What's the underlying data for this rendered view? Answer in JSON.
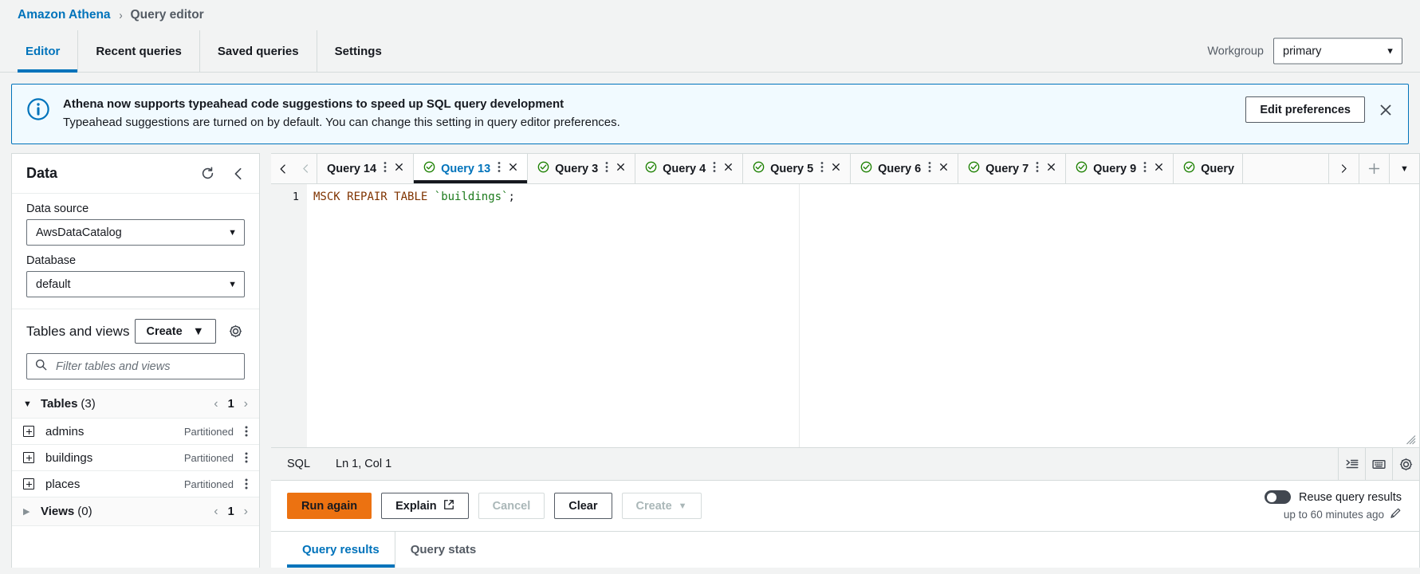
{
  "breadcrumb": {
    "root": "Amazon Athena",
    "separator": "›",
    "current": "Query editor"
  },
  "topnav": {
    "tabs": [
      {
        "label": "Editor",
        "active": true
      },
      {
        "label": "Recent queries",
        "active": false
      },
      {
        "label": "Saved queries",
        "active": false
      },
      {
        "label": "Settings",
        "active": false
      }
    ],
    "workgroup_label": "Workgroup",
    "workgroup_value": "primary"
  },
  "notification": {
    "icon": "info-icon",
    "title": "Athena now supports typeahead code suggestions to speed up SQL query development",
    "text": "Typeahead suggestions are turned on by default. You can change this setting in query editor preferences.",
    "action_label": "Edit preferences",
    "dismiss_icon": "close-icon",
    "accent_color": "#0073bb",
    "background_color": "#f1faff"
  },
  "sidebar": {
    "title": "Data",
    "refresh_icon": "refresh-icon",
    "collapse_icon": "chevron-left-icon",
    "data_source_label": "Data source",
    "data_source_value": "AwsDataCatalog",
    "database_label": "Database",
    "database_value": "default",
    "tables_views_title": "Tables and views",
    "create_label": "Create",
    "settings_icon": "gear-icon",
    "filter_placeholder": "Filter tables and views",
    "filter_value": "",
    "groups": [
      {
        "name": "Tables",
        "count": "(3)",
        "expanded": true,
        "page": "1",
        "items": [
          {
            "name": "admins",
            "badge": "Partitioned"
          },
          {
            "name": "buildings",
            "badge": "Partitioned"
          },
          {
            "name": "places",
            "badge": "Partitioned"
          }
        ]
      },
      {
        "name": "Views",
        "count": "(0)",
        "expanded": false,
        "page": "1",
        "items": []
      }
    ]
  },
  "editor": {
    "tabs": [
      {
        "label": "Query 14",
        "active": false,
        "status": "none"
      },
      {
        "label": "Query 13",
        "active": true,
        "status": "success"
      },
      {
        "label": "Query 3",
        "active": false,
        "status": "success"
      },
      {
        "label": "Query 4",
        "active": false,
        "status": "success"
      },
      {
        "label": "Query 5",
        "active": false,
        "status": "success"
      },
      {
        "label": "Query 6",
        "active": false,
        "status": "success"
      },
      {
        "label": "Query 7",
        "active": false,
        "status": "success"
      },
      {
        "label": "Query 9",
        "active": false,
        "status": "success"
      },
      {
        "label": "Query",
        "active": false,
        "status": "success"
      }
    ],
    "tab_prev_icon": "chevron-left-icon",
    "tab_next_icon": "chevron-right-icon",
    "tab_add_icon": "plus-icon",
    "tab_menu_icon": "chevron-down-icon",
    "line_number": "1",
    "code_tokens": [
      {
        "text": "MSCK",
        "type": "keyword"
      },
      {
        "text": " ",
        "type": "plain"
      },
      {
        "text": "REPAIR",
        "type": "keyword"
      },
      {
        "text": " ",
        "type": "plain"
      },
      {
        "text": "TABLE",
        "type": "keyword"
      },
      {
        "text": " ",
        "type": "plain"
      },
      {
        "text": "`buildings`",
        "type": "identifier"
      },
      {
        "text": ";",
        "type": "punct"
      }
    ],
    "code_text": "MSCK REPAIR TABLE `buildings`;",
    "status_language": "SQL",
    "status_position": "Ln 1, Col 1",
    "status_icons": [
      "format-indent-icon",
      "keyboard-icon",
      "gear-icon"
    ]
  },
  "actions": {
    "run_label": "Run again",
    "explain_label": "Explain",
    "explain_icon": "external-link-icon",
    "cancel_label": "Cancel",
    "cancel_disabled": true,
    "clear_label": "Clear",
    "create_label": "Create",
    "create_disabled": true,
    "primary_color": "#ec7211"
  },
  "reuse": {
    "label": "Reuse query results",
    "enabled": false,
    "sub_label": "up to 60 minutes ago",
    "edit_icon": "pencil-icon"
  },
  "results": {
    "tabs": [
      {
        "label": "Query results",
        "active": true
      },
      {
        "label": "Query stats",
        "active": false
      }
    ]
  }
}
